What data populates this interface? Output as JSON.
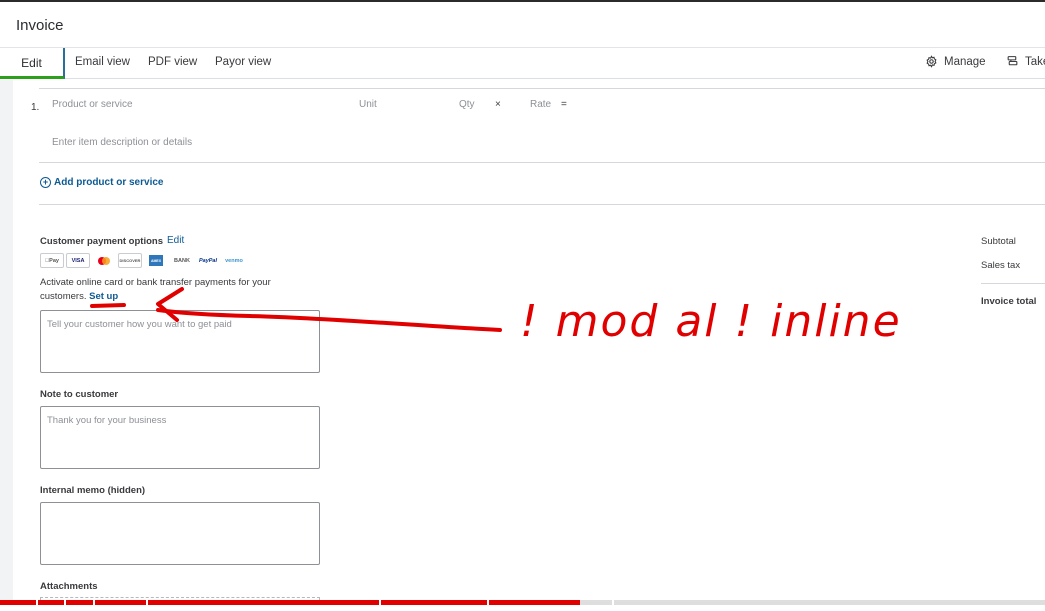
{
  "header": {
    "title": "Invoice"
  },
  "tabs": [
    {
      "label": "Edit"
    },
    {
      "label": "Email view"
    },
    {
      "label": "PDF view"
    },
    {
      "label": "Payor view"
    }
  ],
  "toolbar": {
    "manage_label": "Manage",
    "take_label": "Take"
  },
  "line_items": {
    "row_number": "1.",
    "product_placeholder": "Product or service",
    "unit_label": "Unit",
    "qty_label": "Qty",
    "times_sign": "×",
    "rate_label": "Rate",
    "equals_sign": "=",
    "description_placeholder": "Enter item description or details",
    "add_label": "Add product or service"
  },
  "payment_options": {
    "label": "Customer payment options",
    "edit_label": "Edit",
    "logos": [
      "Pay",
      "VISA",
      "",
      "DISCOVER",
      "AMEX",
      "BANK",
      "PayPal",
      "venmo"
    ],
    "activate_text": "Activate online card or bank transfer payments for your customers.",
    "setup_label": "Set up",
    "message_placeholder": "Tell your customer how you want to get paid"
  },
  "note": {
    "label": "Note to customer",
    "placeholder": "Thank you for your business"
  },
  "memo": {
    "label": "Internal memo (hidden)",
    "placeholder": ""
  },
  "attachments": {
    "label": "Attachments"
  },
  "summary": {
    "subtotal_label": "Subtotal",
    "sales_tax_label": "Sales tax",
    "total_label": "Invoice total"
  },
  "annotation": {
    "text": "! mod al ! inline"
  },
  "video": {
    "progress": 0.555
  },
  "colors": {
    "accent_green": "#2ca01c",
    "link_blue": "#0d5a93",
    "annotation_red": "#e00000"
  }
}
